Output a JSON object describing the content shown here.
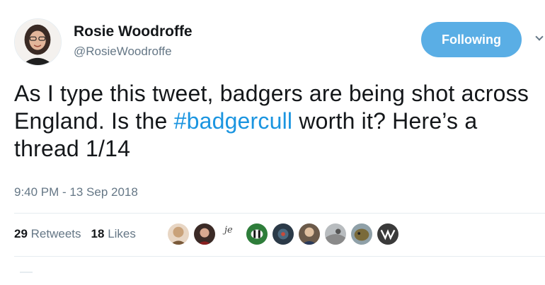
{
  "user": {
    "display_name": "Rosie Woodroffe",
    "handle": "@RosieWoodroffe"
  },
  "follow_button": {
    "label": "Following"
  },
  "tweet": {
    "text_before": "As I type this tweet, badgers are being shot across England. Is the ",
    "hashtag": "#badgercull",
    "text_after": " worth it? Here’s a thread 1/14",
    "timestamp": "9:40 PM - 13 Sep 2018"
  },
  "stats": {
    "retweets_count": "29",
    "retweets_label": "Retweets",
    "likes_count": "18",
    "likes_label": "Likes"
  },
  "likers": [
    {
      "icon": "liker-avatar-1",
      "color": "#c9a27a"
    },
    {
      "icon": "liker-avatar-2",
      "color": "#3b2a26"
    },
    {
      "icon": "liker-avatar-3",
      "color": "#ffffff"
    },
    {
      "icon": "liker-avatar-4",
      "color": "#2e7d3a"
    },
    {
      "icon": "liker-avatar-5",
      "color": "#2b3a48"
    },
    {
      "icon": "liker-avatar-6",
      "color": "#6b5a4a"
    },
    {
      "icon": "liker-avatar-7",
      "color": "#8a8a8a"
    },
    {
      "icon": "liker-avatar-8",
      "color": "#7a6a3a"
    },
    {
      "icon": "liker-avatar-9",
      "color": "#3a3a3a"
    }
  ],
  "colors": {
    "accent": "#1b95e0",
    "button": "#5aaee5",
    "muted": "#657786"
  }
}
